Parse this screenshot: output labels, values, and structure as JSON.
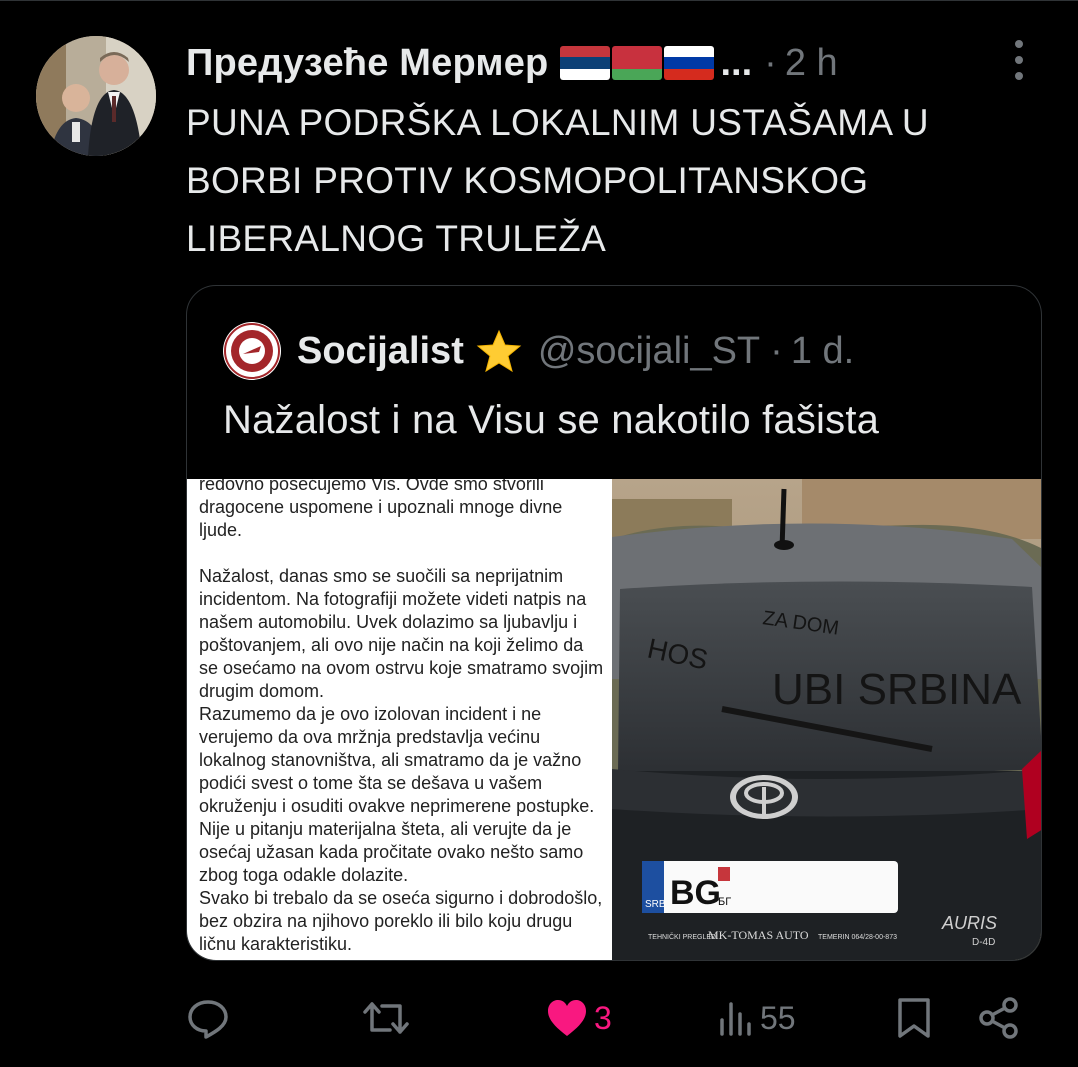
{
  "post": {
    "display_name": "Предузеће Мермер",
    "ellipsis": "...",
    "separator": "·",
    "time": "2 h",
    "text": "PUNA PODRŠKA LOKALNIM USTAŠAMA U BORBI PROTIV KOSMOPOLITANSKOG LIBERALNOG TRULEŽA",
    "flags": [
      "serbia-flag",
      "belarus-flag",
      "russia-flag"
    ]
  },
  "quote": {
    "display_name": "Socijalist",
    "badge": "star-emoji",
    "handle": "@socijali_ST",
    "separator": "·",
    "time": "1 d.",
    "text": "Nažalost i na Visu se nakotilo fašista",
    "document_paragraphs": [
      "redovno posećujemo Vis. Ovde smo stvorili dragocene uspomene i upoznali mnoge divne ljude.",
      "",
      "Nažalost, danas smo se suočili sa neprijatnim incidentom. Na fotografiji možete videti natpis na našem automobilu. Uvek dolazimo sa ljubavlju i poštovanjem, ali ovo nije način na koji želimo da se osećamo na ovom ostrvu koje smatramo svojim drugim domom.",
      "Razumemo da je ovo izolovan incident i ne verujemo da ova mržnja predstavlja većinu lokalnog stanovništva, ali smatramo da je važno podići svest o tome šta se dešava u vašem okruženju i osuditi ovakve neprimerene postupke. Nije u pitanju materijalna šteta, ali verujte da je osećaj užasan kada pročitate ovako nešto samo zbog toga odakle dolazite.",
      "Svako bi trebalo da se oseća sigurno i dobrodošlo, bez obzira na njihovo poreklo ili bilo koju drugu ličnu karakteristiku."
    ],
    "photo": {
      "graffiti": [
        "HOS",
        "ZA DOM",
        "UBI SRBINA"
      ],
      "plate_prefix": "BG",
      "plate_country": "SRB",
      "plate_city_cyr": "БГ",
      "dealer_frame_left": "TEHNIČKI PREGLED",
      "dealer_frame": "MK-TOMAS AUTO",
      "dealer_frame_right": "TEMERIN   064/28-00-873",
      "model_badge": "AURIS",
      "model_sub": "D-4D"
    }
  },
  "actions": {
    "reply": {
      "icon": "reply-icon",
      "count": ""
    },
    "repost": {
      "icon": "repost-icon",
      "count": ""
    },
    "like": {
      "icon": "heart-icon",
      "count": "3",
      "color": "#f91880"
    },
    "views": {
      "icon": "views-icon",
      "count": "55"
    },
    "bookmark": {
      "icon": "bookmark-icon"
    },
    "share": {
      "icon": "share-icon"
    }
  },
  "colors": {
    "background": "#000000",
    "text": "#e7e9ea",
    "muted": "#71767b",
    "border": "#2f3336",
    "like": "#f91880"
  }
}
